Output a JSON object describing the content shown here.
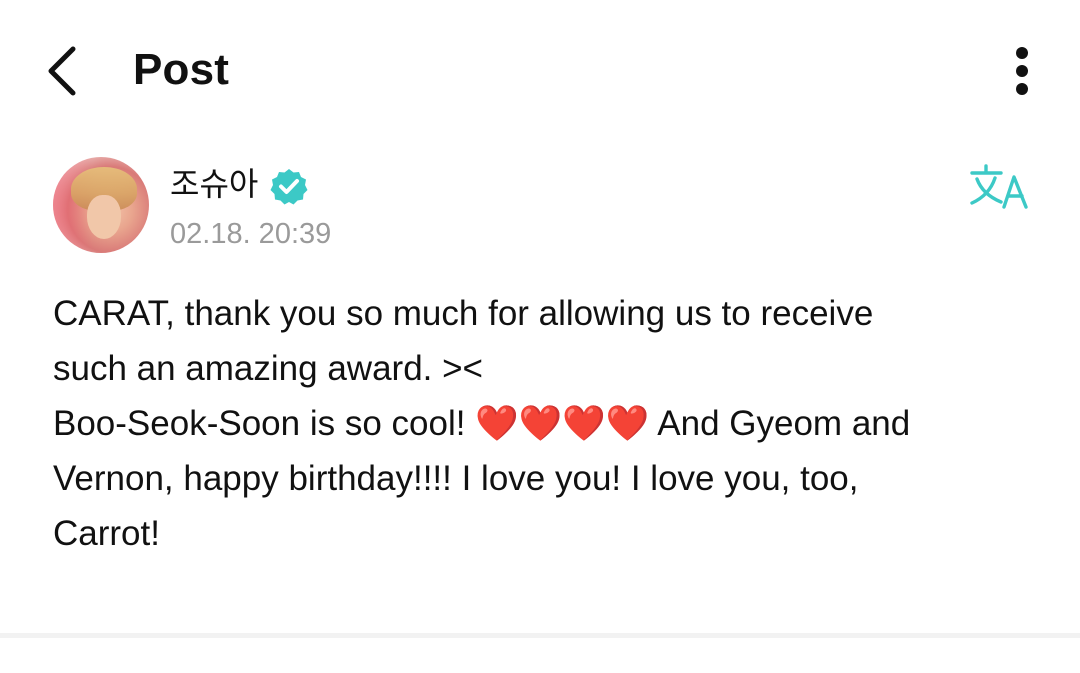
{
  "app_bar": {
    "back_icon": "chevron-left-icon",
    "title": "Post",
    "more_icon": "more-vertical-icon"
  },
  "post": {
    "author": {
      "name": "조슈아",
      "verified_icon": "verified-badge-icon",
      "avatar_icon": "profile-photo"
    },
    "timestamp": "02.18. 20:39",
    "translate_icon": "translate-icon",
    "body_line1": "CARAT, thank you so much for allowing us to receive",
    "body_line2": "such an amazing award. ><",
    "body_line3": "Boo-Seok-Soon is so cool! ❤️❤️❤️❤️ And Gyeom and",
    "body_line4": "Vernon, happy birthday!!!! I love you! I love you, too,",
    "body_line5": "Carrot!"
  },
  "colors": {
    "accent": "#3cc9c6",
    "text_primary": "#111111",
    "text_secondary": "#9a9a9a",
    "divider": "#f2f2f2"
  }
}
